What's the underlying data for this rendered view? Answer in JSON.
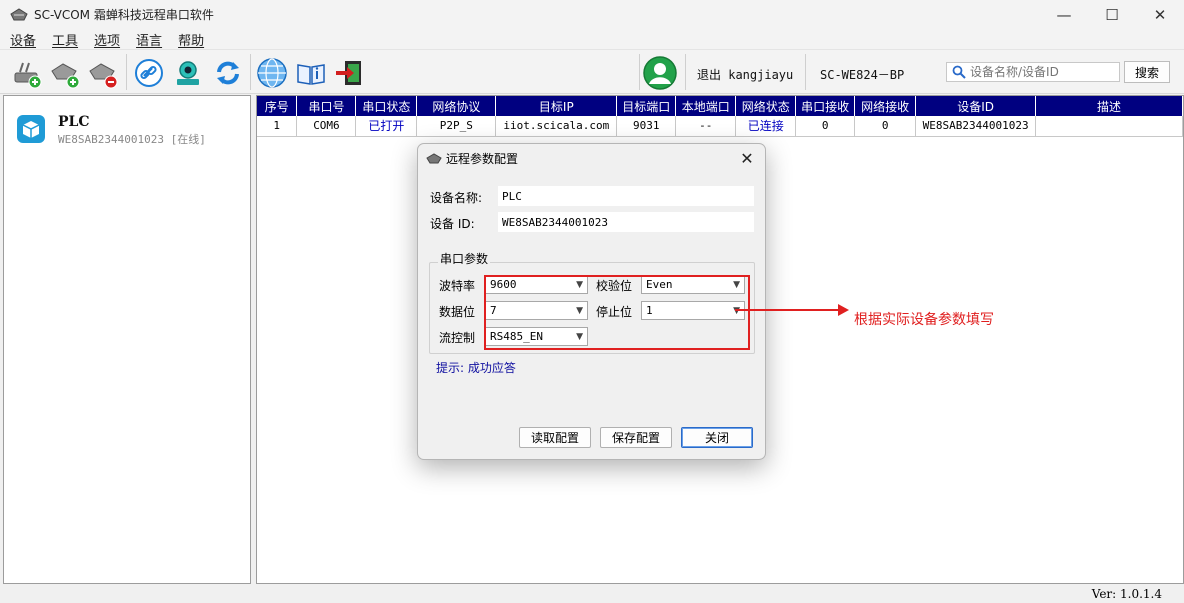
{
  "window": {
    "title": "SC-VCOM 霜蝉科技远程串口软件",
    "minimize": "—",
    "maximize": "☐",
    "close": "✕"
  },
  "menu": [
    "设备",
    "工具",
    "选项",
    "语言",
    "帮助"
  ],
  "toolbar": {
    "user": "退出 kangjiayu",
    "model": "SC-WE824－BP",
    "search_placeholder": "设备名称/设备ID",
    "search_button": "搜索"
  },
  "devices": [
    {
      "name": "PLC",
      "id_status": "WE8SAB2344001023 [在线]"
    }
  ],
  "table": {
    "headers": [
      "序号",
      "串口号",
      "串口状态",
      "网络协议",
      "目标IP",
      "目标端口",
      "本地端口",
      "网络状态",
      "串口接收",
      "网络接收",
      "设备ID",
      "描述"
    ],
    "rows": [
      [
        "1",
        "COM6",
        "已打开",
        "P2P_S",
        "iiot.scicala.com",
        "9031",
        "--",
        "已连接",
        "0",
        "0",
        "WE8SAB2344001023",
        ""
      ]
    ]
  },
  "dialog": {
    "title": "远程参数配置",
    "close": "✕",
    "device_name_label": "设备名称:",
    "device_name_value": "PLC",
    "device_id_label": "设备 ID:",
    "device_id_value": "WE8SAB2344001023",
    "group_title": "串口参数",
    "baud_label": "波特率",
    "baud_value": "9600",
    "parity_label": "校验位",
    "parity_value": "Even",
    "databits_label": "数据位",
    "databits_value": "7",
    "stopbits_label": "停止位",
    "stopbits_value": "1",
    "flow_label": "流控制",
    "flow_value": "RS485_EN",
    "hint": "提示: 成功应答",
    "read_button": "读取配置",
    "save_button": "保存配置",
    "close_button": "关闭"
  },
  "annotation": "根据实际设备参数填写",
  "status": {
    "version": "Ver: 1.0.1.4"
  },
  "colors": {
    "table_header": "#000080",
    "annotation": "#e02020",
    "status_blue": "#0000c0"
  }
}
